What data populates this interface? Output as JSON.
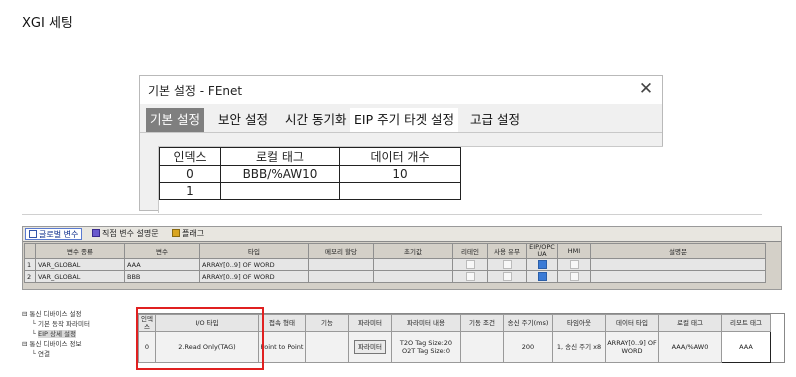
{
  "page": {
    "title": "XGI 세팅"
  },
  "dialog": {
    "title": "기본 설정 - FEnet",
    "close_icon": "close-icon",
    "tabs": [
      {
        "label": "기본 설정"
      },
      {
        "label": "보안 설정"
      },
      {
        "label": "시간 동기화"
      },
      {
        "label": "EIP 주기 타겟 설정"
      },
      {
        "label": "고급 설정"
      }
    ],
    "grid": {
      "headers": [
        "인덱스",
        "로컬 태그",
        "데이터 개수"
      ],
      "rows": [
        [
          "0",
          "BBB/%AW10",
          "10"
        ],
        [
          "1",
          "",
          ""
        ]
      ]
    }
  },
  "variables": {
    "tabs": [
      {
        "label": "글로벌 변수",
        "icon": "global-var-icon"
      },
      {
        "label": "직접 변수 설명문",
        "icon": "direct-var-icon"
      },
      {
        "label": "플래그",
        "icon": "flag-icon"
      }
    ],
    "headers": [
      "변수 종류",
      "변수",
      "타입",
      "메모리 할당",
      "초기값",
      "리테인",
      "사용 유무",
      "EIP/OPC UA",
      "HMI",
      "설명문"
    ],
    "rows": [
      {
        "no": "1",
        "kind": "VAR_GLOBAL",
        "name": "AAA",
        "type": "ARRAY[0..9] OF WORD",
        "eip": true
      },
      {
        "no": "2",
        "kind": "VAR_GLOBAL",
        "name": "BBB",
        "type": "ARRAY[0..9] OF WORD",
        "eip": true
      }
    ]
  },
  "tree": {
    "items": [
      "통신 디바이스 설정",
      "기본 동작 파라미터",
      "EIP 상세 설정",
      "통신 디바이스 정보",
      "연결"
    ]
  },
  "comm": {
    "headers": [
      "인덱스",
      "I/O 타입",
      "접속 형태",
      "기능",
      "파라미터",
      "파라미터 내용",
      "기동 조건",
      "송신 주기(ms)",
      "타임아웃",
      "데이터 타입",
      "로컬 태그",
      "리모트 태그"
    ],
    "row": {
      "index": "0",
      "io_type": "2.Read Only(TAG)",
      "connection": "Point to Point",
      "function": "",
      "param_button": "파라미터",
      "param_content": "T2O Tag Size:20 O2T Tag Size:0",
      "start_cond": "",
      "period": "200",
      "timeout": "1, 송신 주기 x8",
      "data_type": "ARRAY[0..9] OF WORD",
      "local_tag": "AAA/%AW0",
      "remote_tag": "AAA"
    }
  }
}
